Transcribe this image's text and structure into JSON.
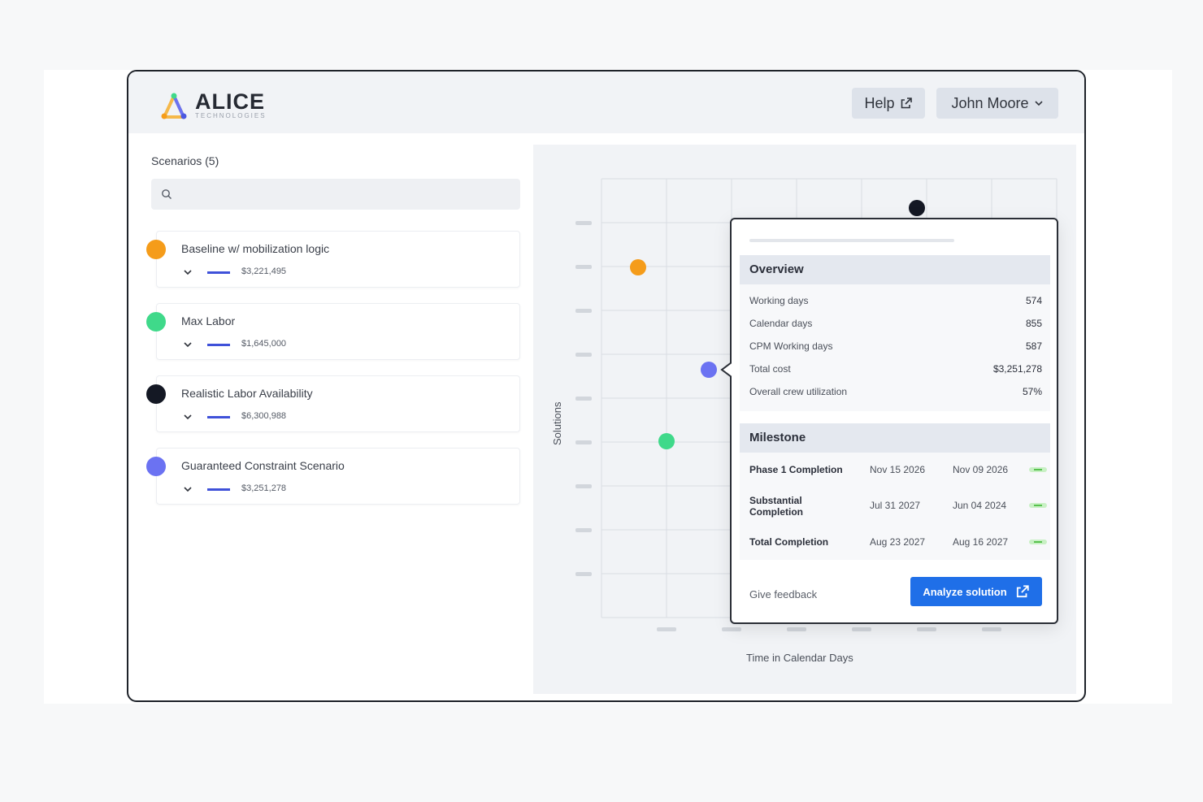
{
  "app": {
    "logo_text": "ALICE",
    "logo_sub": "TECHNOLOGIES",
    "help_label": "Help",
    "user_name": "John Moore"
  },
  "sidebar": {
    "title": "Scenarios (5)",
    "search_placeholder": "",
    "scenarios": [
      {
        "name": "Baseline w/ mobilization logic",
        "cost": "$3,221,495",
        "color": "#f59c1a"
      },
      {
        "name": "Max Labor",
        "cost": "$1,645,000",
        "color": "#3fd98a"
      },
      {
        "name": "Realistic Labor Availability",
        "cost": "$6,300,988",
        "color": "#141824"
      },
      {
        "name": "Guaranteed Constraint Scenario",
        "cost": "$3,251,278",
        "color": "#6b72f2"
      }
    ]
  },
  "chart": {
    "xlabel": "Time in Calendar Days",
    "ylabel": "Solutions"
  },
  "tooltip": {
    "overview_title": "Overview",
    "overview": [
      {
        "label": "Working days",
        "value": "574"
      },
      {
        "label": "Calendar days",
        "value": "855"
      },
      {
        "label": "CPM Working days",
        "value": "587"
      },
      {
        "label": "Total cost",
        "value": "$3,251,278"
      },
      {
        "label": "Overall crew utilization",
        "value": "57%"
      }
    ],
    "milestone_title": "Milestone",
    "milestones": [
      {
        "name": "Phase 1 Completion",
        "date1": "Nov 15 2026",
        "date2": "Nov 09 2026"
      },
      {
        "name": "Substantial Completion",
        "date1": "Jul 31 2027",
        "date2": "Jun 04 2024"
      },
      {
        "name": "Total Completion",
        "date1": "Aug 23 2027",
        "date2": "Aug 16 2027"
      }
    ],
    "feedback_label": "Give feedback",
    "analyze_label": "Analyze solution"
  },
  "colors": {
    "accent": "#1f6fe8",
    "cost_line": "#3f51d9"
  }
}
